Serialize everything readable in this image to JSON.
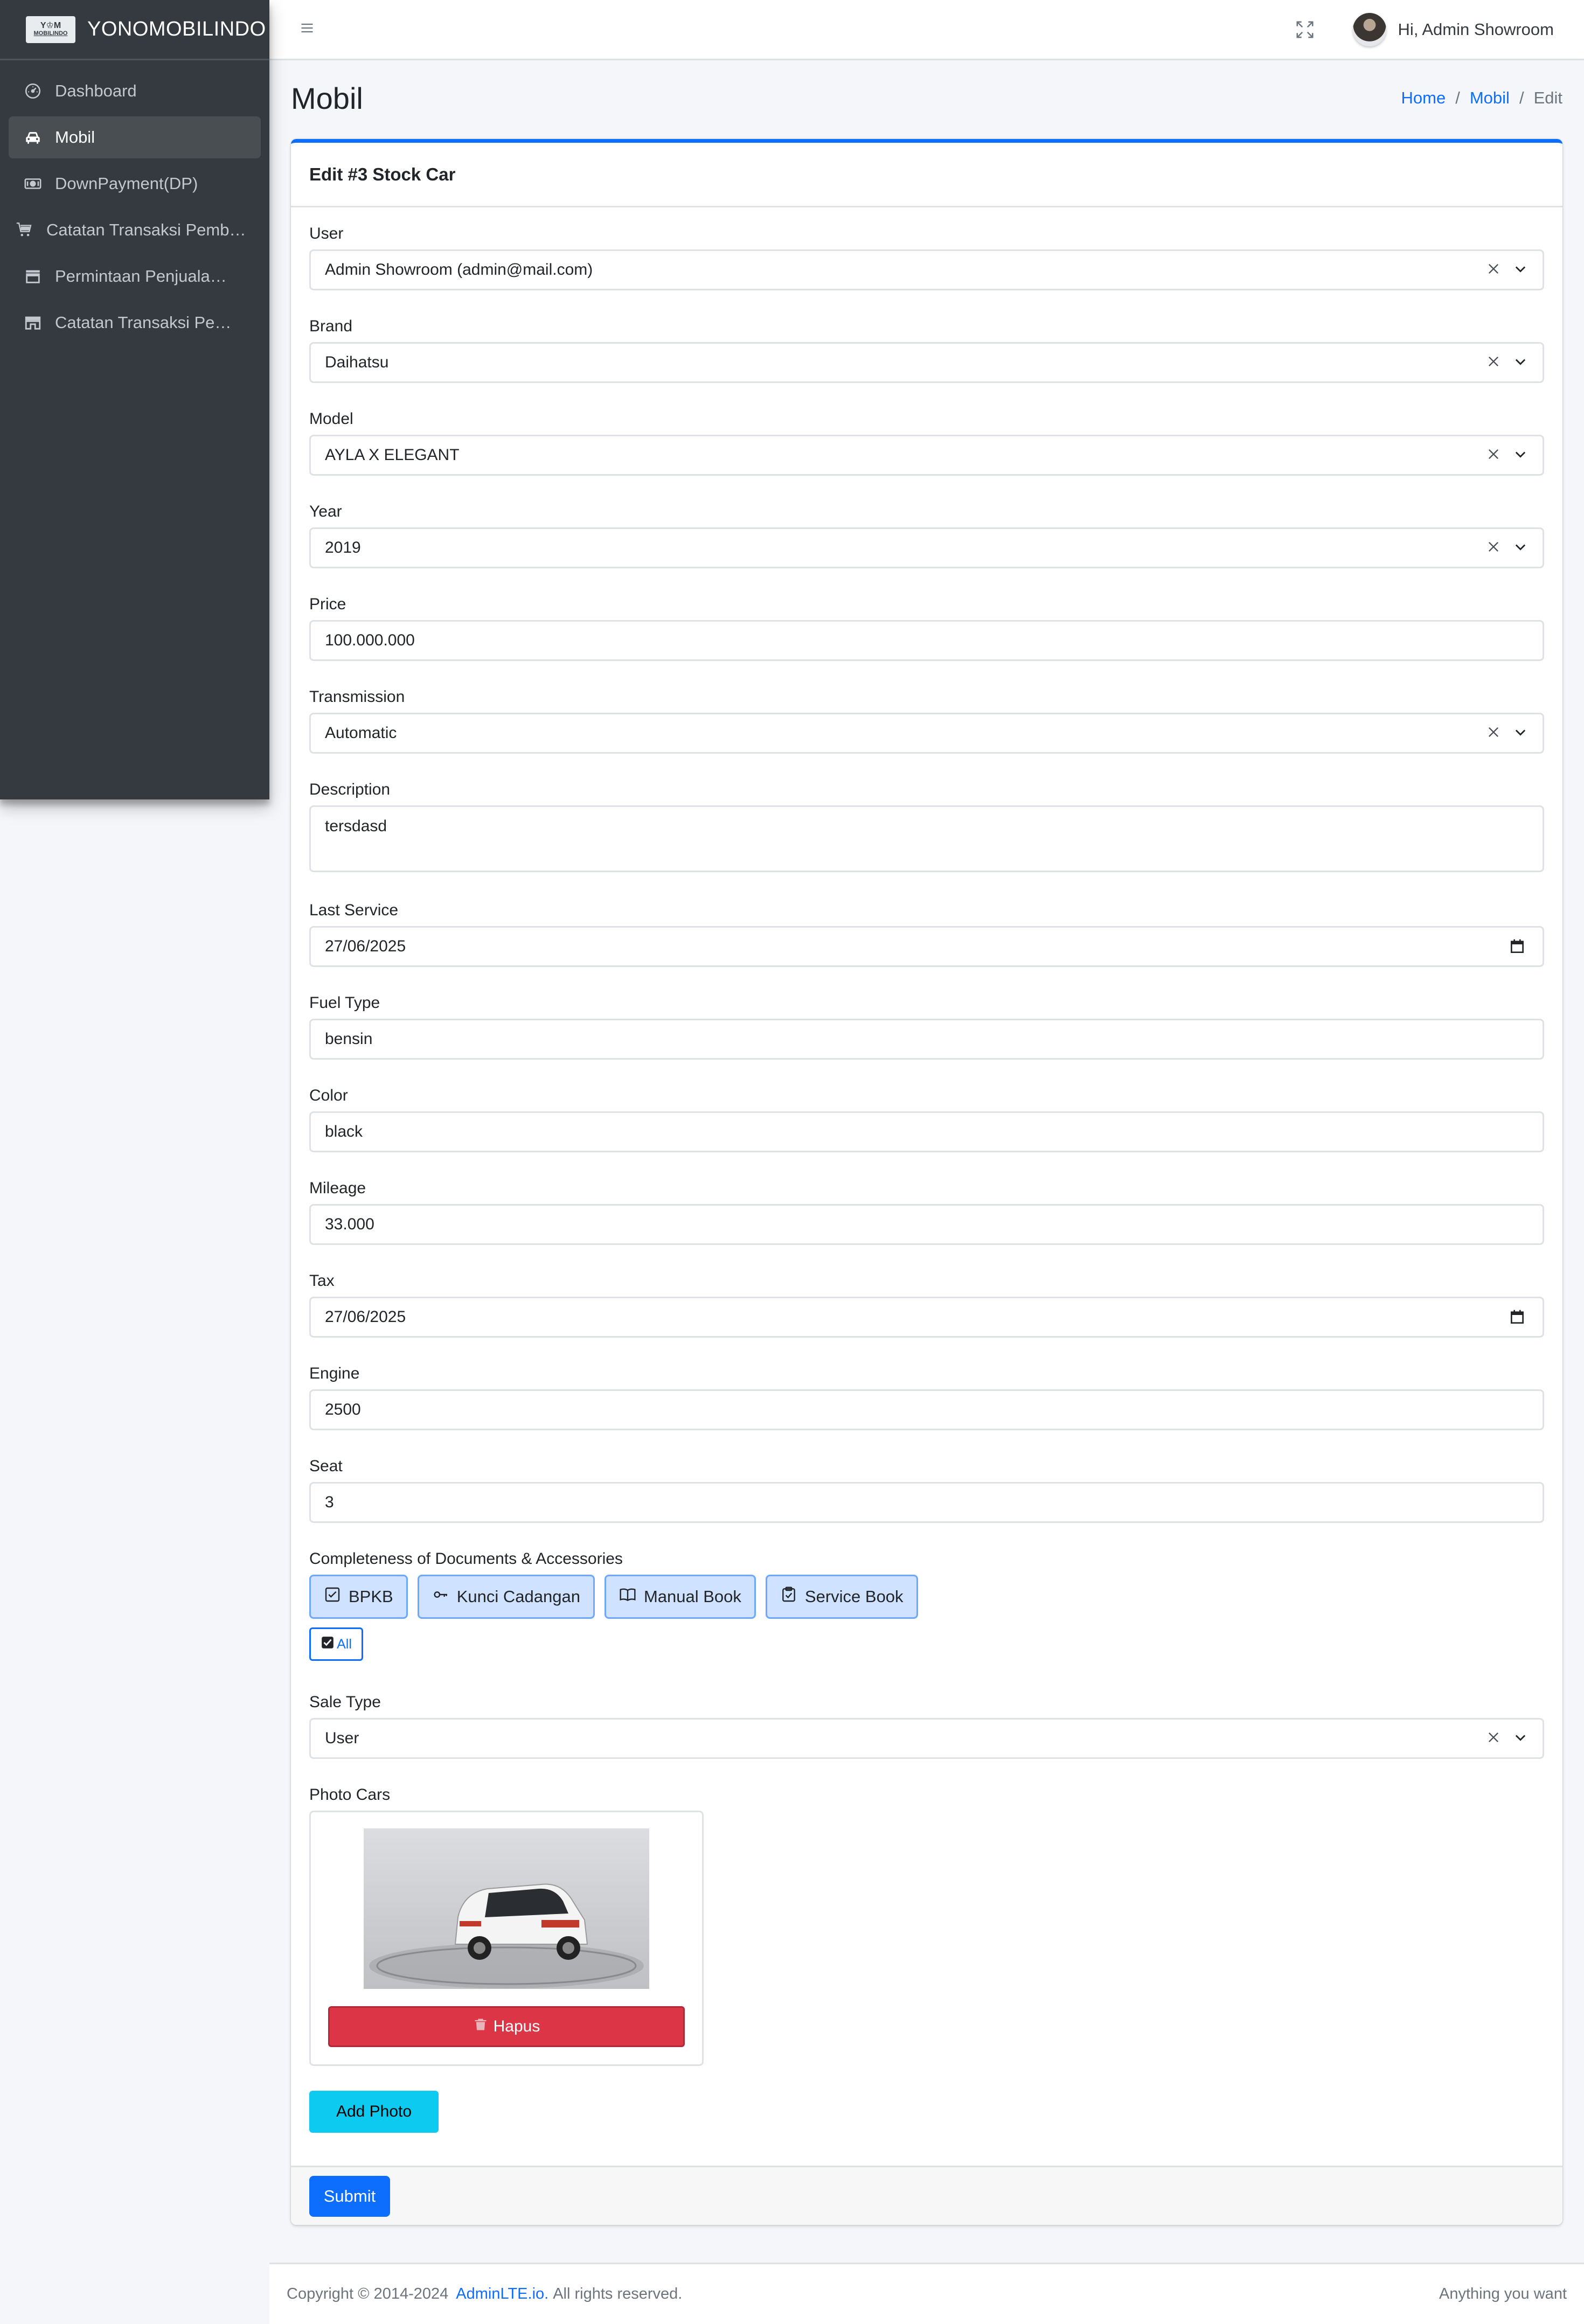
{
  "brand": {
    "name": "YONOMOBILINDO",
    "logo_text": "Y♔M",
    "logo_sub": "MOBILINDO"
  },
  "sidebar": {
    "items": [
      {
        "label": "Dashboard",
        "icon": "dashboard-icon",
        "active": false
      },
      {
        "label": "Mobil",
        "icon": "car-icon",
        "active": true
      },
      {
        "label": "DownPayment(DP)",
        "icon": "cash-icon",
        "active": false
      },
      {
        "label": "Catatan Transaksi Pembelian",
        "icon": "cart-icon",
        "active": false
      },
      {
        "label": "Permintaan Penjualan Mobil",
        "icon": "store-icon",
        "active": false
      },
      {
        "label": "Catatan Transaksi Penjualan",
        "icon": "shop-icon",
        "active": false
      }
    ]
  },
  "topbar": {
    "user_greeting": "Hi, Admin Showroom"
  },
  "header": {
    "title": "Mobil",
    "breadcrumb": {
      "home": "Home",
      "mobil": "Mobil",
      "current": "Edit",
      "separator": "/"
    }
  },
  "card": {
    "title": "Edit #3 Stock Car",
    "fields": {
      "user": {
        "label": "User",
        "value": "Admin Showroom (admin@mail.com)"
      },
      "brand": {
        "label": "Brand",
        "value": "Daihatsu"
      },
      "model": {
        "label": "Model",
        "value": "AYLA X ELEGANT"
      },
      "year": {
        "label": "Year",
        "value": "2019"
      },
      "price": {
        "label": "Price",
        "value": "100.000.000"
      },
      "transmission": {
        "label": "Transmission",
        "value": "Automatic"
      },
      "description": {
        "label": "Description",
        "value": "tersdasd"
      },
      "last_service": {
        "label": "Last Service",
        "value": "27/06/2025"
      },
      "fuel_type": {
        "label": "Fuel Type",
        "value": "bensin"
      },
      "color": {
        "label": "Color",
        "value": "black"
      },
      "mileage": {
        "label": "Mileage",
        "value": "33.000"
      },
      "tax": {
        "label": "Tax",
        "value": "27/06/2025"
      },
      "engine": {
        "label": "Engine",
        "value": "2500"
      },
      "seat": {
        "label": "Seat",
        "value": "3"
      },
      "sale_type": {
        "label": "Sale Type",
        "value": "User"
      }
    },
    "completeness": {
      "label": "Completeness of Documents & Accessories",
      "items": [
        "BPKB",
        "Kunci Cadangan",
        "Manual Book",
        "Service Book"
      ],
      "all_label": "All"
    },
    "photos": {
      "label": "Photo Cars",
      "delete_label": "Hapus",
      "add_label": "Add Photo"
    },
    "submit_label": "Submit"
  },
  "footer": {
    "copyright": "Copyright © 2014-2024",
    "link": "AdminLTE.io.",
    "rights": "All rights reserved.",
    "right_text": "Anything you want"
  },
  "colors": {
    "sidebar_bg": "#343a40",
    "primary": "#0d6efd",
    "danger": "#dc3545",
    "info": "#0dcaf0",
    "chip_bg": "#cfe2ff"
  }
}
